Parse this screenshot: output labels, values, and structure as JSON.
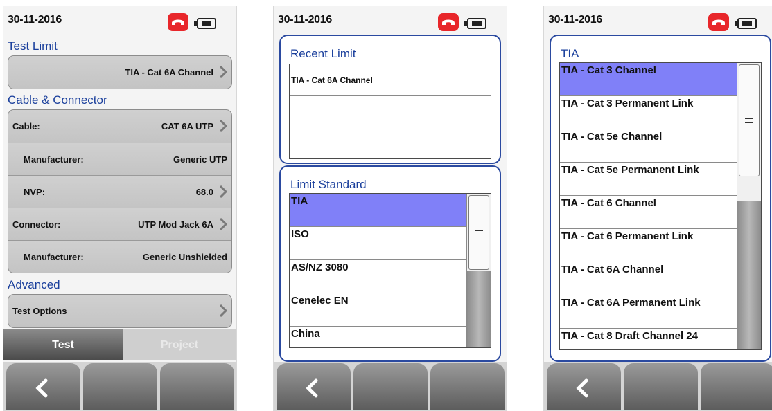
{
  "screen1": {
    "date": "30-11-2016",
    "test_limit": {
      "title": "Test Limit",
      "value": "TIA - Cat 6A Channel"
    },
    "cable_connector": {
      "title": "Cable & Connector",
      "rows": [
        {
          "label": "Cable:",
          "value": "CAT 6A UTP"
        },
        {
          "label": "Manufacturer:",
          "value": "Generic UTP"
        },
        {
          "label": "NVP:",
          "value": "68.0"
        },
        {
          "label": "Connector:",
          "value": "UTP Mod Jack 6A"
        },
        {
          "label": "Manufacturer:",
          "value": "Generic Unshielded"
        }
      ]
    },
    "advanced": {
      "title": "Advanced",
      "test_options": "Test Options"
    },
    "tabs": {
      "test": "Test",
      "project": "Project"
    }
  },
  "screen2": {
    "date": "30-11-2016",
    "recent_limit": {
      "title": "Recent Limit",
      "items": [
        "TIA - Cat 6A Channel"
      ]
    },
    "limit_standard": {
      "title": "Limit Standard",
      "items": [
        "TIA",
        "ISO",
        "AS/NZ 3080",
        "Cenelec EN",
        "China"
      ],
      "selected": "TIA"
    }
  },
  "screen3": {
    "date": "30-11-2016",
    "title": "TIA",
    "items": [
      "TIA - Cat 3 Channel",
      "TIA - Cat 3 Permanent Link",
      "TIA - Cat 5e Channel",
      "TIA - Cat 5e Permanent Link",
      "TIA - Cat 6 Channel",
      "TIA - Cat 6 Permanent Link",
      "TIA - Cat 6A Channel",
      "TIA - Cat 6A Permanent Link",
      "TIA - Cat 8 Draft Channel 24"
    ],
    "selected": "TIA - Cat 3 Channel"
  },
  "icons": {
    "status": [
      "phone-icon",
      "battery-icon"
    ],
    "nav": [
      "back-icon"
    ],
    "row": "chevron-right-icon"
  },
  "colors": {
    "accent": "#1a3f9c",
    "phone": "#e8262a",
    "selection": "#8080f8"
  }
}
